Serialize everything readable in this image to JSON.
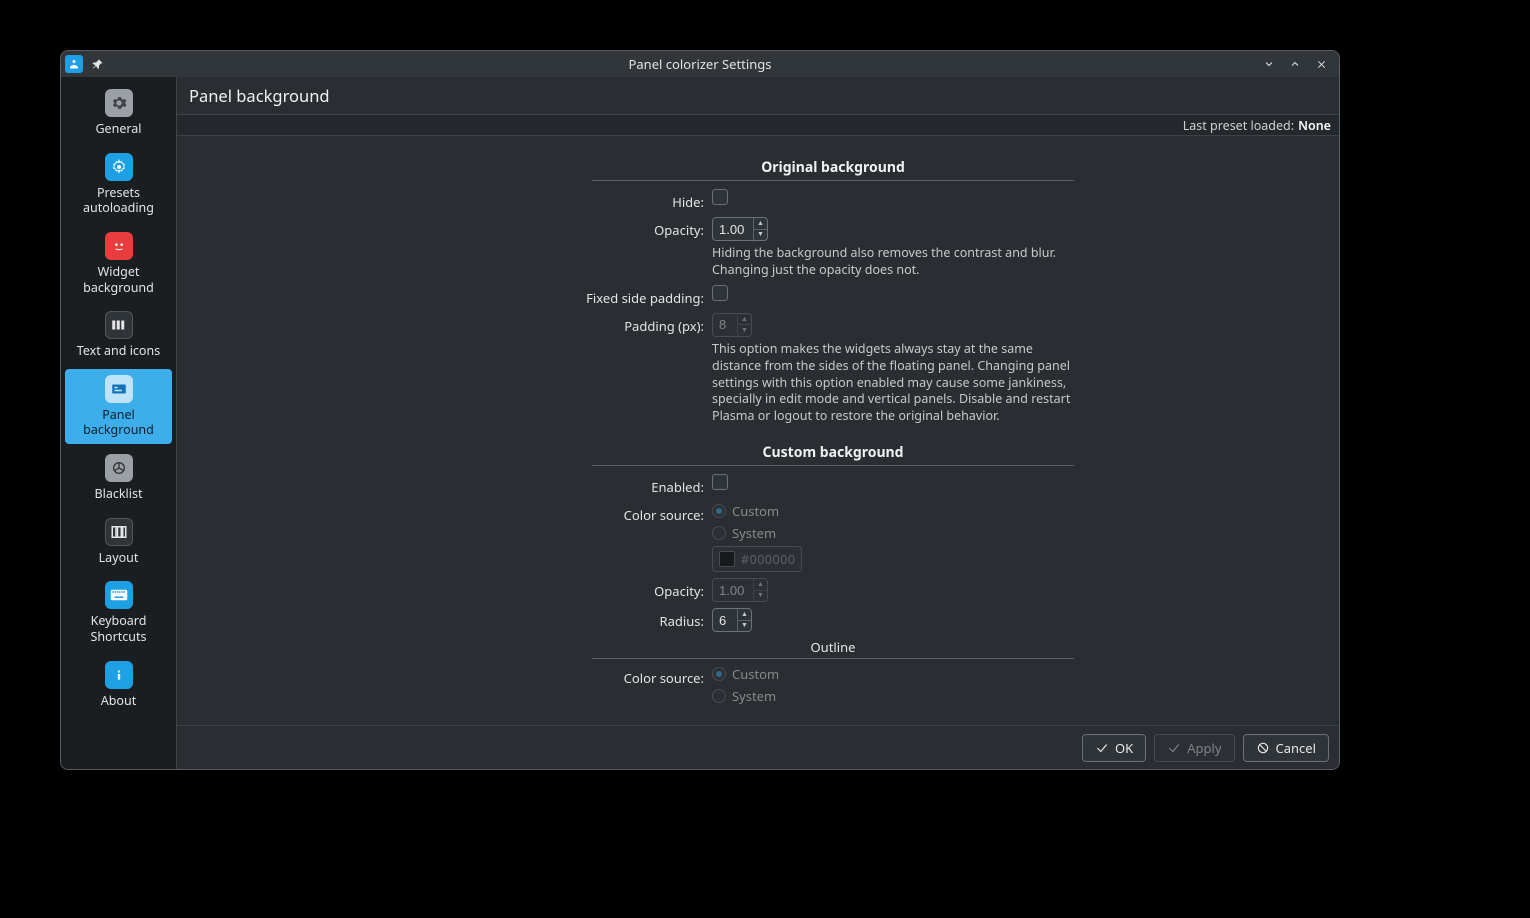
{
  "window": {
    "title": "Panel colorizer Settings"
  },
  "sidebar": {
    "items": [
      {
        "label": "General"
      },
      {
        "label": "Presets autoloading"
      },
      {
        "label": "Widget background"
      },
      {
        "label": "Text and icons"
      },
      {
        "label": "Panel background"
      },
      {
        "label": "Blacklist"
      },
      {
        "label": "Layout"
      },
      {
        "label": "Keyboard Shortcuts"
      },
      {
        "label": "About"
      }
    ]
  },
  "header": {
    "page_title": "Panel background",
    "preset_label": "Last preset loaded:",
    "preset_value": "None"
  },
  "sections": {
    "original": {
      "title": "Original background",
      "hide_label": "Hide:",
      "opacity_label": "Opacity:",
      "opacity_value": "1.00",
      "opacity_help": "Hiding the background also removes the contrast and blur. Changing just the opacity does not.",
      "fixed_side_label": "Fixed side padding:",
      "padding_label": "Padding (px):",
      "padding_value": "8",
      "padding_help": "This option makes the widgets always stay at the same distance from the sides of the floating panel. Changing panel settings with this option enabled may cause some jankiness, specially in edit mode and vertical panels. Disable and restart Plasma or logout to restore the original behavior."
    },
    "custom": {
      "title": "Custom background",
      "enabled_label": "Enabled:",
      "color_source_label": "Color source:",
      "radio_custom": "Custom",
      "radio_system": "System",
      "color_hex": "#000000",
      "opacity_label": "Opacity:",
      "opacity_value": "1.00",
      "radius_label": "Radius:",
      "radius_value": "6",
      "outline_label": "Outline",
      "outline_color_source_label": "Color source:",
      "outline_radio_custom": "Custom",
      "outline_radio_system": "System"
    }
  },
  "footer": {
    "ok": "OK",
    "apply": "Apply",
    "cancel": "Cancel"
  }
}
